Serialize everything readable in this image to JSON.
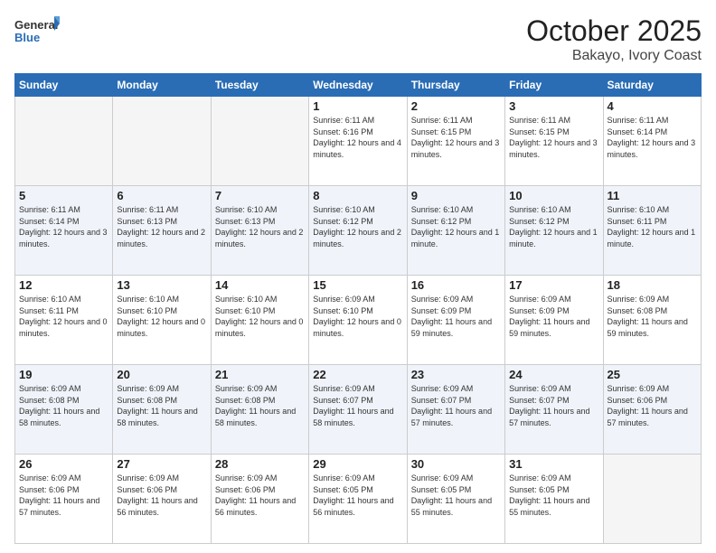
{
  "header": {
    "logo": {
      "general": "General",
      "blue": "Blue"
    },
    "title": "October 2025",
    "subtitle": "Bakayo, Ivory Coast"
  },
  "weekdays": [
    "Sunday",
    "Monday",
    "Tuesday",
    "Wednesday",
    "Thursday",
    "Friday",
    "Saturday"
  ],
  "weeks": [
    [
      {
        "day": null,
        "info": null
      },
      {
        "day": null,
        "info": null
      },
      {
        "day": null,
        "info": null
      },
      {
        "day": "1",
        "sunrise": "Sunrise: 6:11 AM",
        "sunset": "Sunset: 6:16 PM",
        "daylight": "Daylight: 12 hours and 4 minutes."
      },
      {
        "day": "2",
        "sunrise": "Sunrise: 6:11 AM",
        "sunset": "Sunset: 6:15 PM",
        "daylight": "Daylight: 12 hours and 3 minutes."
      },
      {
        "day": "3",
        "sunrise": "Sunrise: 6:11 AM",
        "sunset": "Sunset: 6:15 PM",
        "daylight": "Daylight: 12 hours and 3 minutes."
      },
      {
        "day": "4",
        "sunrise": "Sunrise: 6:11 AM",
        "sunset": "Sunset: 6:14 PM",
        "daylight": "Daylight: 12 hours and 3 minutes."
      }
    ],
    [
      {
        "day": "5",
        "sunrise": "Sunrise: 6:11 AM",
        "sunset": "Sunset: 6:14 PM",
        "daylight": "Daylight: 12 hours and 3 minutes."
      },
      {
        "day": "6",
        "sunrise": "Sunrise: 6:11 AM",
        "sunset": "Sunset: 6:13 PM",
        "daylight": "Daylight: 12 hours and 2 minutes."
      },
      {
        "day": "7",
        "sunrise": "Sunrise: 6:10 AM",
        "sunset": "Sunset: 6:13 PM",
        "daylight": "Daylight: 12 hours and 2 minutes."
      },
      {
        "day": "8",
        "sunrise": "Sunrise: 6:10 AM",
        "sunset": "Sunset: 6:12 PM",
        "daylight": "Daylight: 12 hours and 2 minutes."
      },
      {
        "day": "9",
        "sunrise": "Sunrise: 6:10 AM",
        "sunset": "Sunset: 6:12 PM",
        "daylight": "Daylight: 12 hours and 1 minute."
      },
      {
        "day": "10",
        "sunrise": "Sunrise: 6:10 AM",
        "sunset": "Sunset: 6:12 PM",
        "daylight": "Daylight: 12 hours and 1 minute."
      },
      {
        "day": "11",
        "sunrise": "Sunrise: 6:10 AM",
        "sunset": "Sunset: 6:11 PM",
        "daylight": "Daylight: 12 hours and 1 minute."
      }
    ],
    [
      {
        "day": "12",
        "sunrise": "Sunrise: 6:10 AM",
        "sunset": "Sunset: 6:11 PM",
        "daylight": "Daylight: 12 hours and 0 minutes."
      },
      {
        "day": "13",
        "sunrise": "Sunrise: 6:10 AM",
        "sunset": "Sunset: 6:10 PM",
        "daylight": "Daylight: 12 hours and 0 minutes."
      },
      {
        "day": "14",
        "sunrise": "Sunrise: 6:10 AM",
        "sunset": "Sunset: 6:10 PM",
        "daylight": "Daylight: 12 hours and 0 minutes."
      },
      {
        "day": "15",
        "sunrise": "Sunrise: 6:09 AM",
        "sunset": "Sunset: 6:10 PM",
        "daylight": "Daylight: 12 hours and 0 minutes."
      },
      {
        "day": "16",
        "sunrise": "Sunrise: 6:09 AM",
        "sunset": "Sunset: 6:09 PM",
        "daylight": "Daylight: 11 hours and 59 minutes."
      },
      {
        "day": "17",
        "sunrise": "Sunrise: 6:09 AM",
        "sunset": "Sunset: 6:09 PM",
        "daylight": "Daylight: 11 hours and 59 minutes."
      },
      {
        "day": "18",
        "sunrise": "Sunrise: 6:09 AM",
        "sunset": "Sunset: 6:08 PM",
        "daylight": "Daylight: 11 hours and 59 minutes."
      }
    ],
    [
      {
        "day": "19",
        "sunrise": "Sunrise: 6:09 AM",
        "sunset": "Sunset: 6:08 PM",
        "daylight": "Daylight: 11 hours and 58 minutes."
      },
      {
        "day": "20",
        "sunrise": "Sunrise: 6:09 AM",
        "sunset": "Sunset: 6:08 PM",
        "daylight": "Daylight: 11 hours and 58 minutes."
      },
      {
        "day": "21",
        "sunrise": "Sunrise: 6:09 AM",
        "sunset": "Sunset: 6:08 PM",
        "daylight": "Daylight: 11 hours and 58 minutes."
      },
      {
        "day": "22",
        "sunrise": "Sunrise: 6:09 AM",
        "sunset": "Sunset: 6:07 PM",
        "daylight": "Daylight: 11 hours and 58 minutes."
      },
      {
        "day": "23",
        "sunrise": "Sunrise: 6:09 AM",
        "sunset": "Sunset: 6:07 PM",
        "daylight": "Daylight: 11 hours and 57 minutes."
      },
      {
        "day": "24",
        "sunrise": "Sunrise: 6:09 AM",
        "sunset": "Sunset: 6:07 PM",
        "daylight": "Daylight: 11 hours and 57 minutes."
      },
      {
        "day": "25",
        "sunrise": "Sunrise: 6:09 AM",
        "sunset": "Sunset: 6:06 PM",
        "daylight": "Daylight: 11 hours and 57 minutes."
      }
    ],
    [
      {
        "day": "26",
        "sunrise": "Sunrise: 6:09 AM",
        "sunset": "Sunset: 6:06 PM",
        "daylight": "Daylight: 11 hours and 57 minutes."
      },
      {
        "day": "27",
        "sunrise": "Sunrise: 6:09 AM",
        "sunset": "Sunset: 6:06 PM",
        "daylight": "Daylight: 11 hours and 56 minutes."
      },
      {
        "day": "28",
        "sunrise": "Sunrise: 6:09 AM",
        "sunset": "Sunset: 6:06 PM",
        "daylight": "Daylight: 11 hours and 56 minutes."
      },
      {
        "day": "29",
        "sunrise": "Sunrise: 6:09 AM",
        "sunset": "Sunset: 6:05 PM",
        "daylight": "Daylight: 11 hours and 56 minutes."
      },
      {
        "day": "30",
        "sunrise": "Sunrise: 6:09 AM",
        "sunset": "Sunset: 6:05 PM",
        "daylight": "Daylight: 11 hours and 55 minutes."
      },
      {
        "day": "31",
        "sunrise": "Sunrise: 6:09 AM",
        "sunset": "Sunset: 6:05 PM",
        "daylight": "Daylight: 11 hours and 55 minutes."
      },
      {
        "day": null,
        "info": null
      }
    ]
  ]
}
